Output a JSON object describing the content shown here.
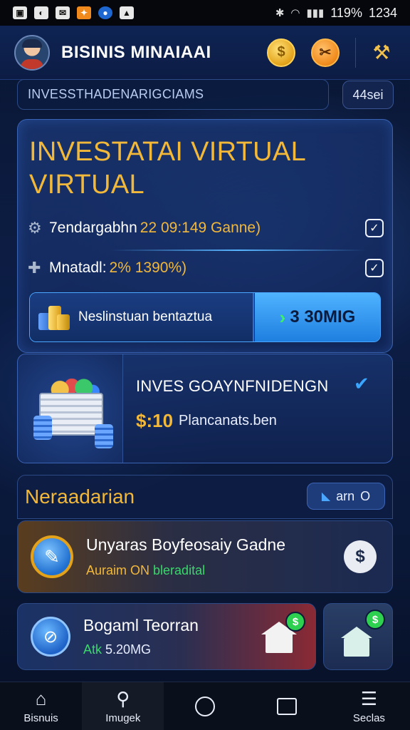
{
  "status_bar": {
    "left_icons": [
      "gallery-icon",
      "app-icon",
      "mail-icon",
      "orange-app-icon",
      "blue-app-icon",
      "photo-icon"
    ],
    "battery": "119%",
    "time": "1234"
  },
  "header": {
    "title": "BISINIS MINAIAAI",
    "coin_symbol": "$"
  },
  "search": {
    "placeholder": "INVESSTHADENARIGCIAMS"
  },
  "chip": {
    "label": "44sei"
  },
  "invest_card": {
    "title_line1": "INVESTATAI VIRTUAL",
    "title_line2": "VIRTUAL",
    "row1": {
      "label": "7endargabhn",
      "value": "22 09:149 Ganne)"
    },
    "row2": {
      "label": "Mnatadl:",
      "value": "2% 1390%)"
    },
    "progress": {
      "label": "Neslinstuan bentaztua",
      "action": "3 30MIG",
      "fraction": 0.64
    }
  },
  "goal_card": {
    "title": "INVES GOAYNFNIDENGN",
    "amount": "$:10",
    "subtitle": "Plancanats.ben"
  },
  "section": {
    "title": "Neraadarian",
    "see_label": "arn"
  },
  "game_card": {
    "name": "Unyaras Boyfeosaiy Gadne",
    "sub_orange": "Auraim ON",
    "sub_green": "bleradital",
    "dollar": "$"
  },
  "card2": {
    "name": "Bogaml Teorran",
    "sub_green": "Atk",
    "sub_white": "5.20MG",
    "badge": "$"
  },
  "card3": {
    "badge": "$"
  },
  "bottom_nav": {
    "items": [
      {
        "label": "Bisnuis",
        "icon": "home-icon"
      },
      {
        "label": "Imugek",
        "icon": "search-icon"
      },
      {
        "label": "",
        "icon": "circle-icon"
      },
      {
        "label": "",
        "icon": "square-icon"
      },
      {
        "label": "Seclas",
        "icon": "menu-icon"
      }
    ]
  },
  "colors": {
    "accent_gold": "#f2b83a",
    "accent_blue": "#4aa6ff",
    "green": "#3ad86a",
    "background": "#0c1d45"
  }
}
